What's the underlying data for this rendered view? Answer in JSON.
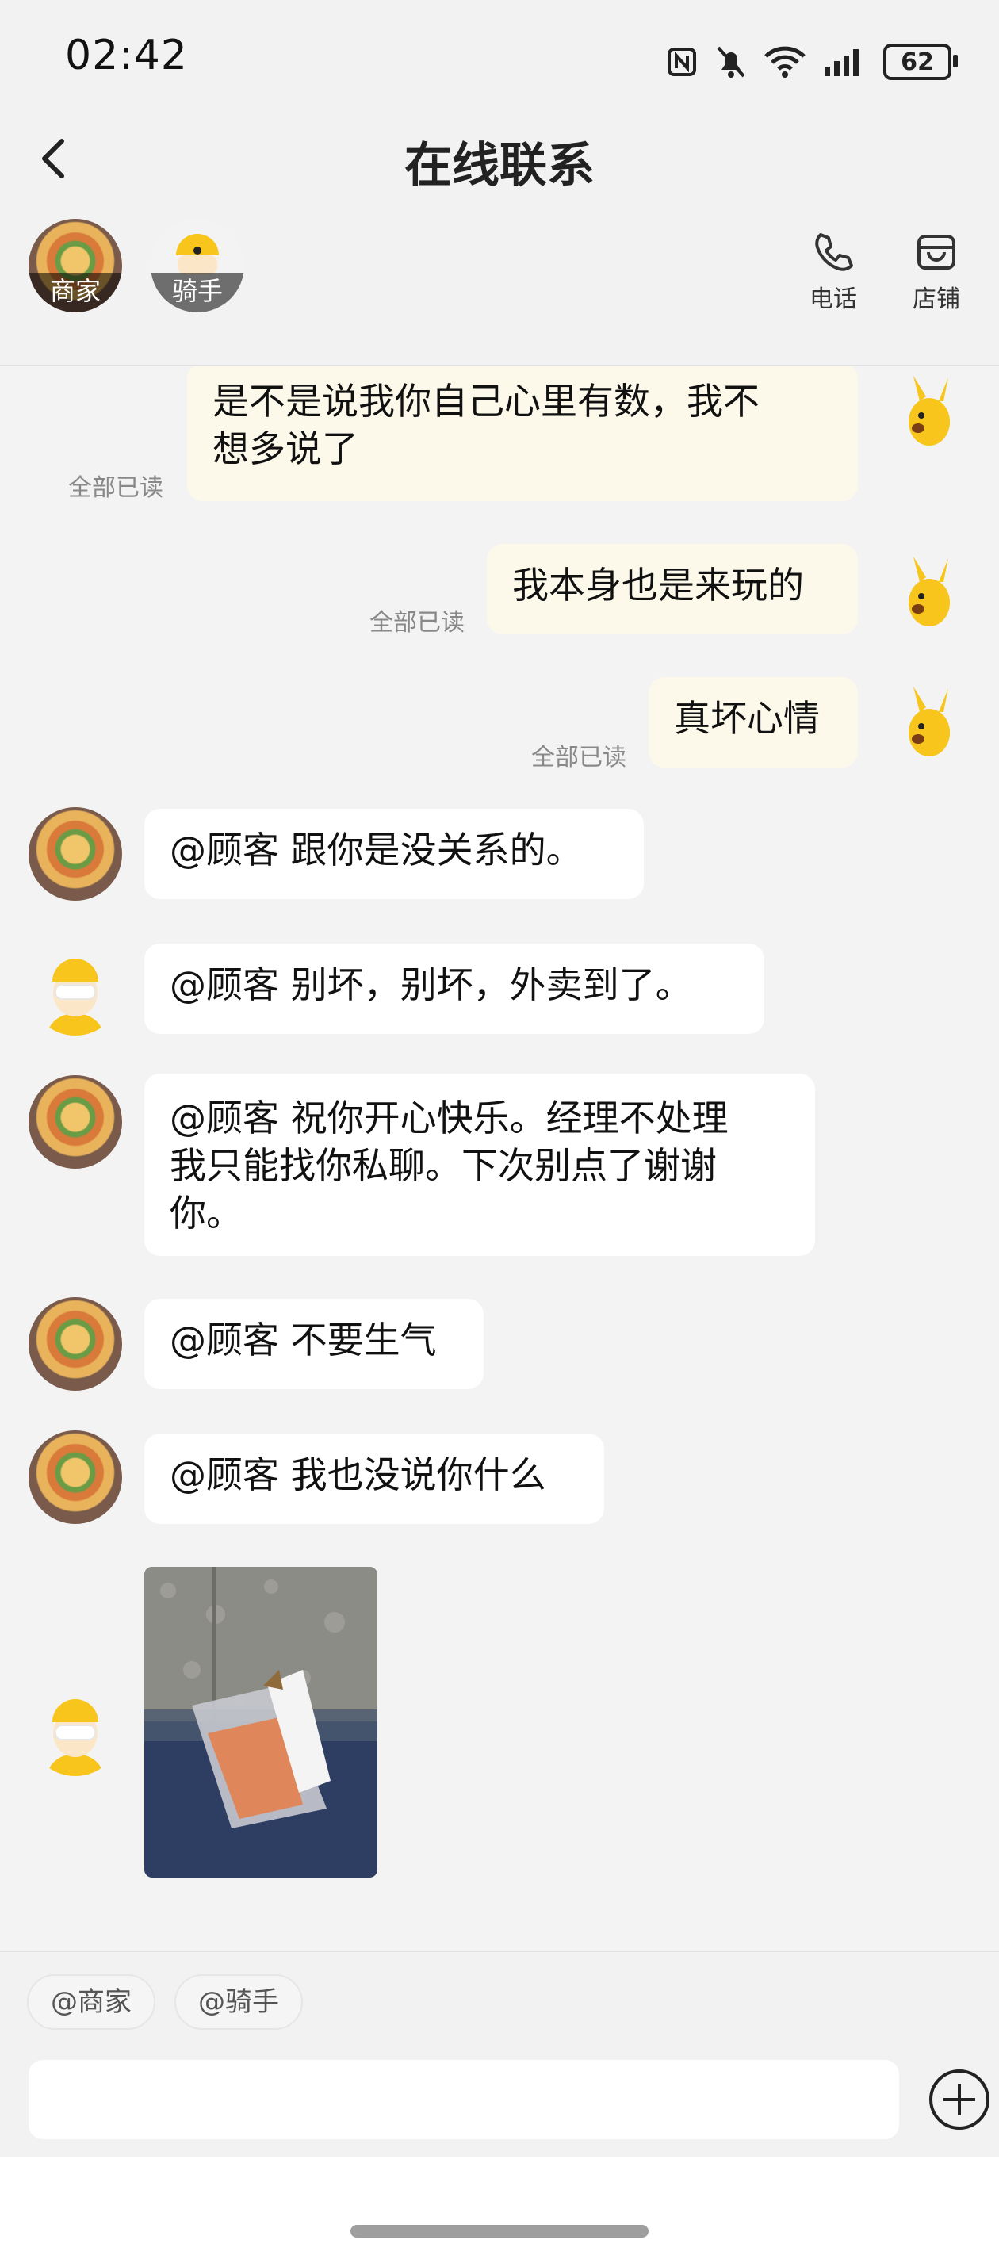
{
  "status_bar": {
    "time": "02:42",
    "battery": "62"
  },
  "header": {
    "title": "在线联系",
    "parties": [
      {
        "label": "商家"
      },
      {
        "label": "骑手"
      }
    ],
    "actions": {
      "phone": "电话",
      "store": "店铺"
    }
  },
  "messages": [
    {
      "from": "customer",
      "text_line1": "是不是说我你自己心里有数，我不",
      "text_line2": "想多说了",
      "read": "全部已读"
    },
    {
      "from": "customer",
      "text": "我本身也是来玩的",
      "read": "全部已读"
    },
    {
      "from": "customer",
      "text": "真坏心情",
      "read": "全部已读"
    },
    {
      "from": "merchant",
      "text": "@顾客 跟你是没关系的。"
    },
    {
      "from": "rider",
      "text": "@顾客 别坏，别坏，外卖到了。"
    },
    {
      "from": "merchant",
      "text_line1": "@顾客 祝你开心快乐。经理不处理",
      "text_line2": "我只能找你私聊。下次别点了谢谢",
      "text_line3": "你。"
    },
    {
      "from": "merchant",
      "text": "@顾客 不要生气"
    },
    {
      "from": "merchant",
      "text": "@顾客 我也没说你什么"
    },
    {
      "from": "rider",
      "type": "photo"
    }
  ],
  "bottom": {
    "chips": [
      "@商家",
      "@骑手"
    ],
    "input_placeholder": ""
  },
  "colors": {
    "my_bubble": "#fcf9ea",
    "their_bubble": "#ffffff",
    "background": "#f3f3f3",
    "accent_yellow": "#f7c51c"
  }
}
